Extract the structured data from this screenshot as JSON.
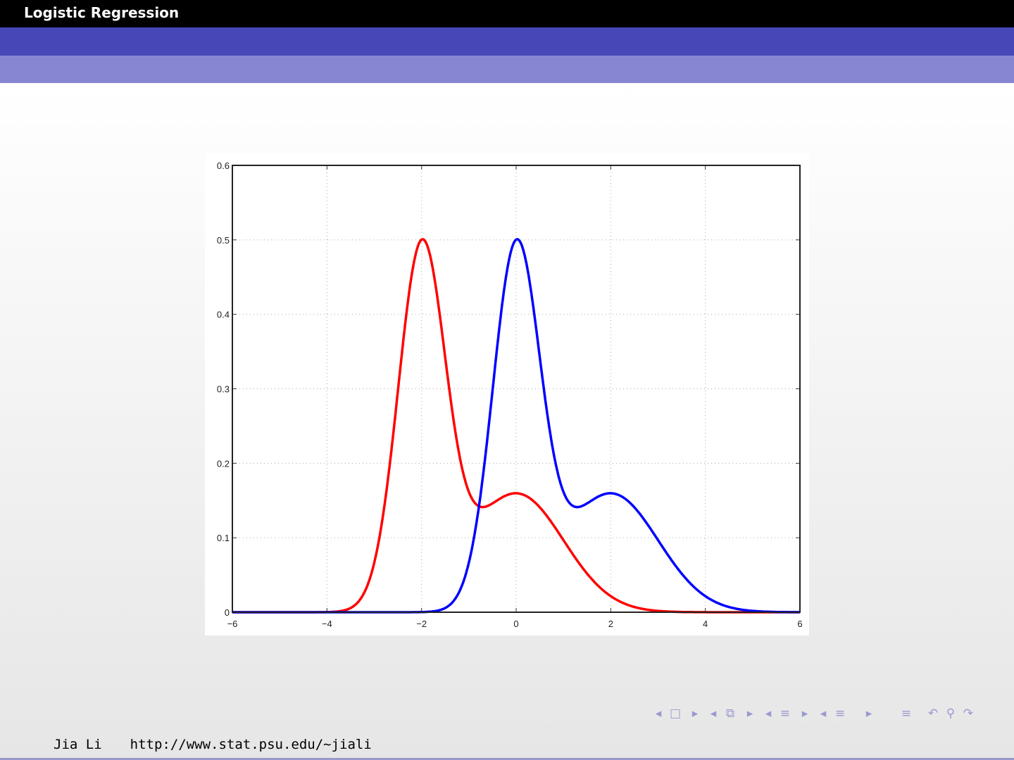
{
  "slide": {
    "title": "Logistic Regression"
  },
  "footer": {
    "author": "Jia Li",
    "url": "http://www.stat.psu.edu/∼jiali"
  },
  "nav_icons": [
    "prev-arrow",
    "frame-icon",
    "next-arrow",
    "prev-arrow",
    "subsection-icon",
    "next-arrow",
    "prev-arrow",
    "section-icon",
    "next-arrow",
    "prev-arrow",
    "section-list-icon",
    "next-arrow",
    "appendix-icon",
    "undo-icon",
    "search-icon",
    "redo-icon"
  ],
  "chart_data": {
    "type": "line",
    "title": "",
    "xlabel": "",
    "ylabel": "",
    "xlim": [
      -6,
      6
    ],
    "ylim": [
      0,
      0.6
    ],
    "xticks": [
      "−6",
      "−4",
      "−2",
      "0",
      "2",
      "4",
      "6"
    ],
    "yticks": [
      "0",
      "0.1",
      "0.2",
      "0.3",
      "0.4",
      "0.5",
      "0.6"
    ],
    "grid": true,
    "x": [
      -6,
      -5,
      -4,
      -3,
      -2,
      -1,
      0,
      1,
      2,
      3,
      4,
      5,
      6
    ],
    "series": [
      {
        "name": "red",
        "color": "#ff0000",
        "components": [
          {
            "weight": 0.6,
            "mean": -2,
            "sd": 0.5
          },
          {
            "weight": 0.4,
            "mean": 0,
            "sd": 1
          }
        ],
        "values": [
          0,
          0,
          0.0002,
          0.0666,
          0.5,
          0.1616,
          0.16,
          0.0968,
          0.0216,
          0.0018,
          0.0001,
          0,
          0
        ]
      },
      {
        "name": "blue",
        "color": "#0000ff",
        "components": [
          {
            "weight": 0.6,
            "mean": 0,
            "sd": 0.5
          },
          {
            "weight": 0.4,
            "mean": 2,
            "sd": 1
          }
        ],
        "values": [
          0,
          0,
          0,
          0,
          0.0002,
          0.0666,
          0.5,
          0.1616,
          0.16,
          0.0968,
          0.0216,
          0.0018,
          0.0001
        ]
      }
    ]
  }
}
